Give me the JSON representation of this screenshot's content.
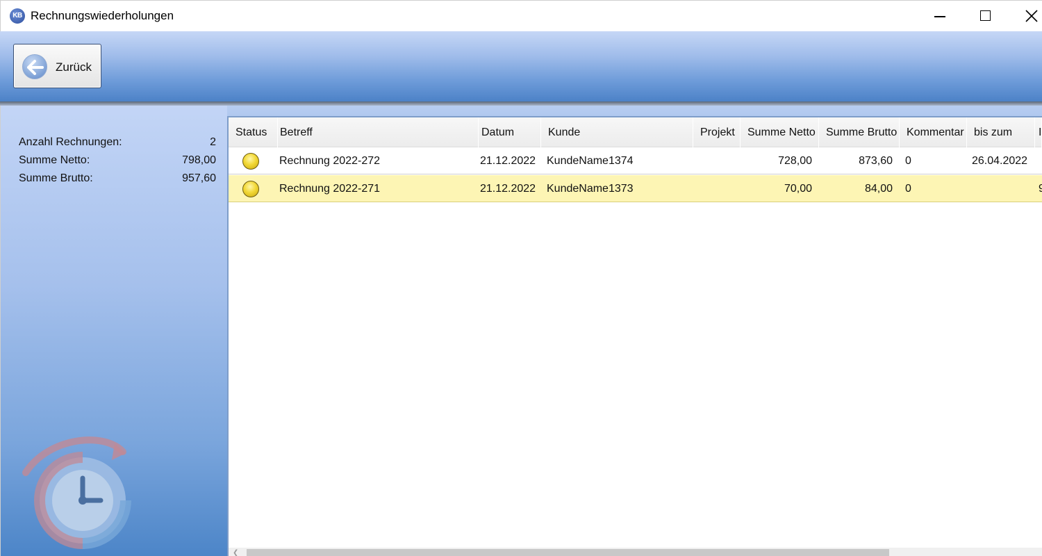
{
  "window": {
    "title": "Rechnungswiederholungen",
    "icon_text": "KB",
    "icon": "kb-app-icon"
  },
  "toolbar": {
    "back_label": "Zurück",
    "back_icon": "arrow-left-icon"
  },
  "summary": [
    {
      "label": "Anzahl Rechnungen:",
      "value": "2"
    },
    {
      "label": "Summe Netto:",
      "value": "798,00"
    },
    {
      "label": "Summe Brutto:",
      "value": "957,60"
    }
  ],
  "grid": {
    "columns": [
      "Status",
      "Betreff",
      "Datum",
      "Kunde",
      "Projekt",
      "Summe Netto",
      "Summe Brutto",
      "Kommentar",
      "bis zum",
      "I"
    ],
    "rows": [
      {
        "status_color": "#f2d837",
        "betreff": "Rechnung 2022-272",
        "datum": "21.12.2022",
        "kunde": "KundeName1374",
        "projekt": "",
        "summe_netto": "728,00",
        "summe_brutto": "873,60",
        "kommentar": "0",
        "bis_zum": "26.04.2022",
        "extra": "",
        "selected": false
      },
      {
        "status_color": "#f2d837",
        "betreff": "Rechnung 2022-271",
        "datum": "21.12.2022",
        "kunde": "KundeName1373",
        "projekt": "",
        "summe_netto": "70,00",
        "summe_brutto": "84,00",
        "kommentar": "0",
        "bis_zum": "",
        "extra": "9",
        "selected": true
      }
    ]
  },
  "colors": {
    "selected_row": "#fdf5b4",
    "toolbar_top": "#c6d7f6",
    "toolbar_bottom": "#4a80c6"
  }
}
